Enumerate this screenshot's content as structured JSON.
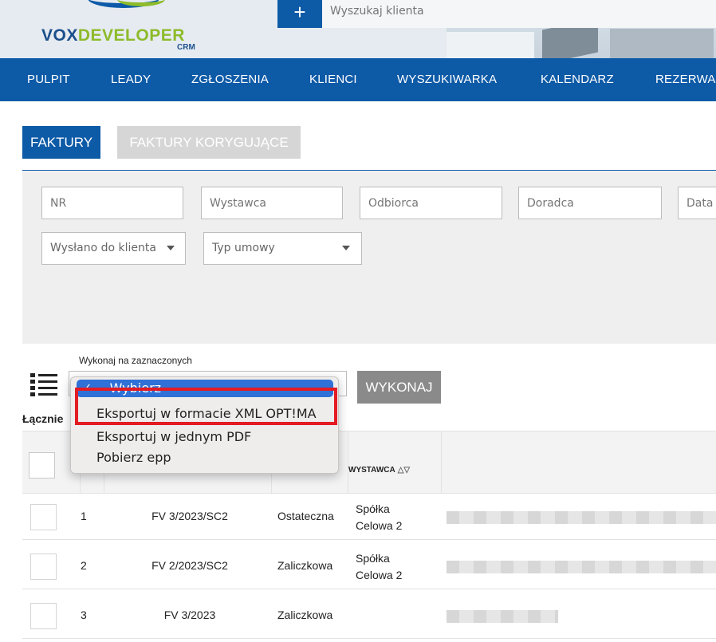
{
  "header": {
    "logo_main": "VOX",
    "logo_dev": "DEVELOPER",
    "logo_sub": "CRM",
    "add_button_glyph": "+",
    "search_placeholder": "Wyszukaj klienta"
  },
  "nav": {
    "items": [
      "PULPIT",
      "LEADY",
      "ZGŁOSZENIA",
      "KLIENCI",
      "WYSZUKIWARKA",
      "KALENDARZ",
      "REZERWA"
    ]
  },
  "tabs": {
    "active": "FAKTURY",
    "inactive": "FAKTURY KORYGUJĄCE"
  },
  "filters": {
    "nr": "NR",
    "wystawca": "Wystawca",
    "odbiorca": "Odbiorca",
    "doradca": "Doradca",
    "data": "Data",
    "wyslano": "Wysłano do klienta",
    "typ_umowy": "Typ umowy"
  },
  "actions": {
    "label": "Wykonaj na zaznaczonych",
    "execute_button": "WYKONAJ",
    "total_label": "Łącznie"
  },
  "dropdown": {
    "selected": "-- Wybierz --",
    "check_glyph": "✓",
    "options": [
      "Eksportuj w formacie XML OPT!MA",
      "Eksportuj w jednym PDF",
      "Pobierz epp"
    ]
  },
  "table": {
    "header_wystawca": "WYSTAWCA",
    "sort_glyphs": "△▽",
    "rows": [
      {
        "num": "1",
        "fv": "FV 3/2023/SC2",
        "typ": "Ostateczna",
        "wystawca_1": "Spółka",
        "wystawca_2": "Celowa 2"
      },
      {
        "num": "2",
        "fv": "FV 2/2023/SC2",
        "typ": "Zaliczkowa",
        "wystawca_1": "Spółka",
        "wystawca_2": "Celowa 2"
      },
      {
        "num": "3",
        "fv": "FV 3/2023",
        "typ": "Zaliczkowa",
        "wystawca_1": "",
        "wystawca_2": ""
      }
    ]
  },
  "colors": {
    "brand_blue": "#0d5aa7",
    "highlight_red": "#e31b23",
    "selected_blue": "#2f71d6"
  }
}
